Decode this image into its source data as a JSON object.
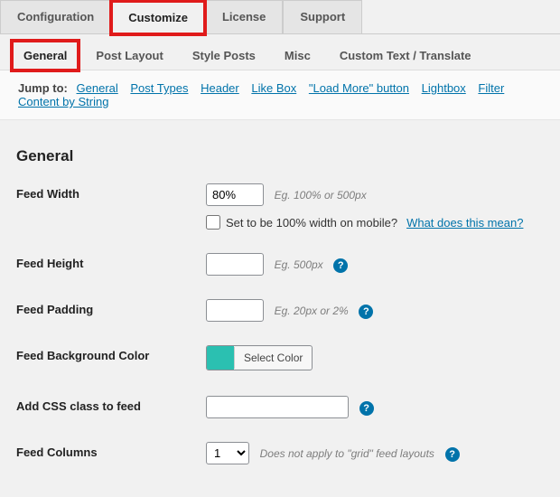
{
  "tabs": {
    "configuration": "Configuration",
    "customize": "Customize",
    "license": "License",
    "support": "Support"
  },
  "subtabs": {
    "general": "General",
    "post_layout": "Post Layout",
    "style_posts": "Style Posts",
    "misc": "Misc",
    "custom_text": "Custom Text / Translate"
  },
  "jumpto": {
    "label": "Jump to:",
    "links": {
      "general": "General",
      "post_types": "Post Types",
      "header": "Header",
      "like_box": "Like Box",
      "load_more": "\"Load More\" button",
      "lightbox": "Lightbox",
      "filter": "Filter Content by String"
    }
  },
  "section": {
    "general_title": "General"
  },
  "fields": {
    "feed_width": {
      "label": "Feed Width",
      "value": "80%",
      "hint": "Eg. 100% or 500px"
    },
    "mobile_100": {
      "label": "Set to be 100% width on mobile?",
      "link": "What does this mean?"
    },
    "feed_height": {
      "label": "Feed Height",
      "value": "",
      "hint": "Eg. 500px"
    },
    "feed_padding": {
      "label": "Feed Padding",
      "value": "",
      "hint": "Eg. 20px or 2%"
    },
    "feed_bg": {
      "label": "Feed Background Color",
      "button": "Select Color",
      "color": "#2bc0b1"
    },
    "css_class": {
      "label": "Add CSS class to feed",
      "value": ""
    },
    "feed_cols": {
      "label": "Feed Columns",
      "value": "1",
      "hint": "Does not apply to \"grid\" feed layouts"
    }
  },
  "glyphs": {
    "help": "?"
  }
}
